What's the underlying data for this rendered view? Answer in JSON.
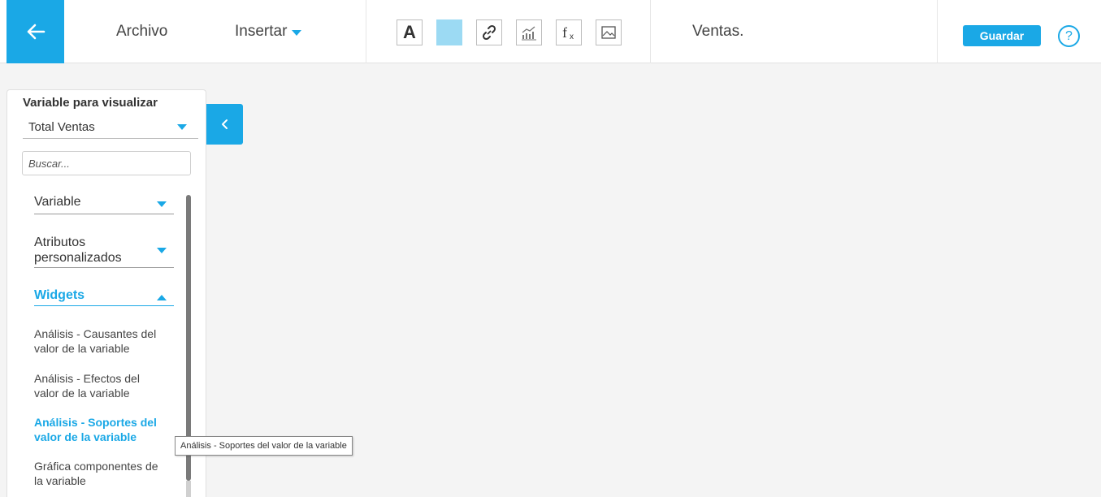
{
  "toolbar": {
    "archivo": "Archivo",
    "insertar": "Insertar",
    "tools": [
      "text-icon",
      "color-swatch",
      "link-icon",
      "chart-icon",
      "formula-icon",
      "image-icon"
    ],
    "text_tool_glyph": "A",
    "doc_title": "Ventas.",
    "save_label": "Guardar",
    "help_glyph": "?"
  },
  "panel": {
    "title": "Variable para visualizar",
    "selected_variable": "Total Ventas",
    "search_placeholder": "Buscar...",
    "sections": {
      "variable": "Variable",
      "atributos_1": "Atributos",
      "atributos_2": "personalizados",
      "widgets": "Widgets"
    },
    "widgets": [
      {
        "line1": "Análisis - Causantes del",
        "line2": "valor de la variable"
      },
      {
        "line1": "Análisis - Efectos del",
        "line2": "valor de la variable"
      },
      {
        "line1": "Análisis - Soportes del",
        "line2": "valor de la variable"
      },
      {
        "line1": "Gráfica componentes de",
        "line2": "la variable"
      }
    ]
  },
  "tooltip": "Análisis - Soportes del valor de la variable",
  "colors": {
    "accent": "#1aa8e6",
    "swatch": "#9cdaf3"
  }
}
